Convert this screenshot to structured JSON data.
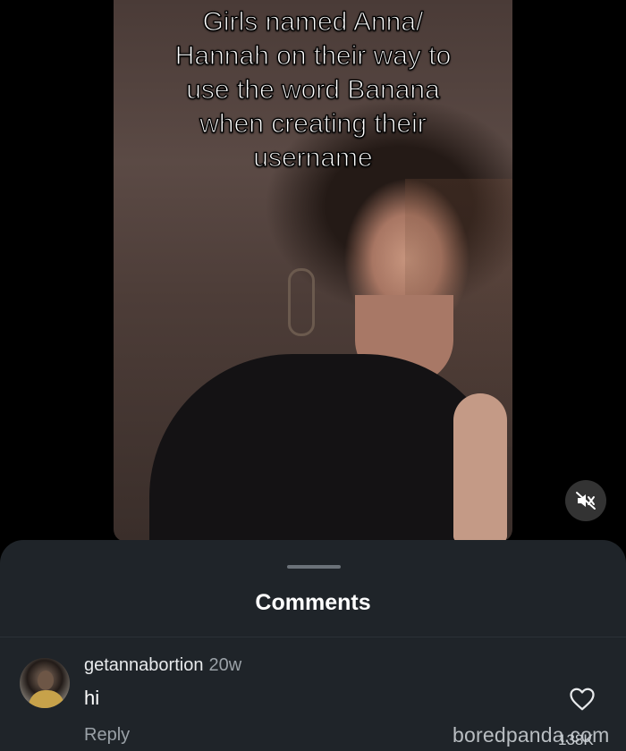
{
  "video": {
    "caption": "Girls named Anna/\nHannah on their way to\nuse the word Banana\nwhen creating their\nusername",
    "mute_icon": "speaker-muted-icon"
  },
  "comments_sheet": {
    "title": "Comments",
    "comments": [
      {
        "username": "getannabortion",
        "time": "20w",
        "text": "hi",
        "reply_label": "Reply",
        "like_icon": "heart-outline-icon",
        "like_count": "138K"
      }
    ]
  },
  "watermark": "boredpanda.com",
  "colors": {
    "background": "#000000",
    "sheet": "#1f2429",
    "secondary_text": "#9aa1a7"
  }
}
